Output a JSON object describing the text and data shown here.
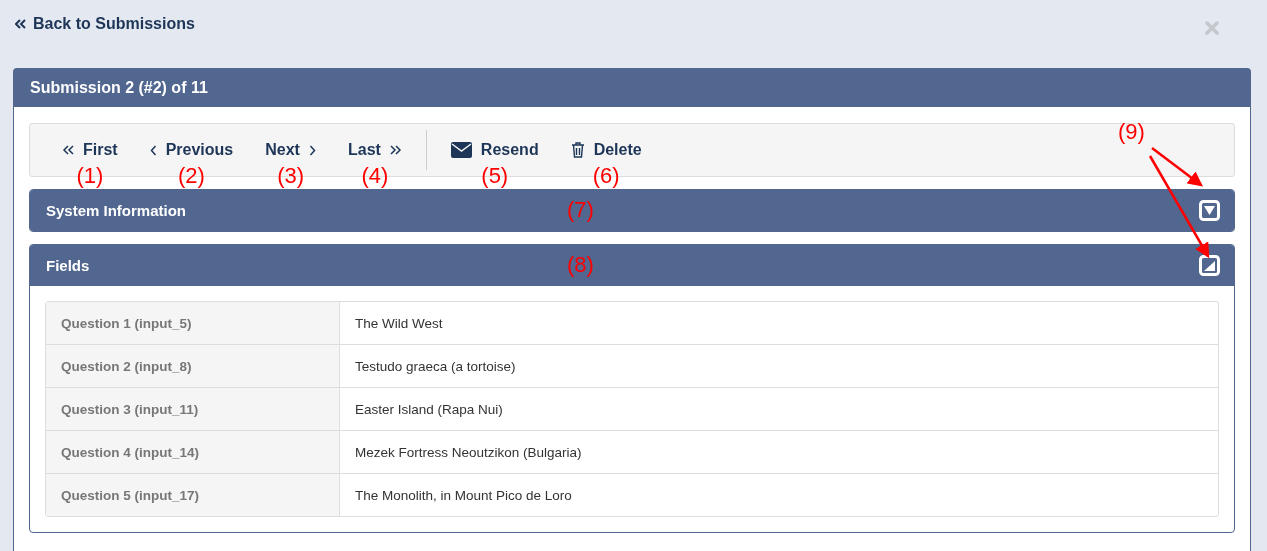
{
  "back_link": {
    "label": "Back to Submissions"
  },
  "panel": {
    "title": "Submission 2 (#2) of 11"
  },
  "toolbar": [
    {
      "kind": "first",
      "label": "First",
      "callout": "(1)"
    },
    {
      "kind": "previous",
      "label": "Previous",
      "callout": "(2)"
    },
    {
      "kind": "next",
      "label": "Next",
      "callout": "(3)"
    },
    {
      "kind": "last",
      "label": "Last",
      "callout": "(4)"
    },
    {
      "kind": "resend",
      "label": "Resend",
      "callout": "(5)"
    },
    {
      "kind": "delete",
      "label": "Delete",
      "callout": "(6)"
    }
  ],
  "sections": [
    {
      "title": "System Information",
      "callout": "(7)",
      "expanded": false
    },
    {
      "title": "Fields",
      "callout": "(8)",
      "expanded": true,
      "rows": [
        {
          "label": "Question 1 (input_5)",
          "value": "The Wild West"
        },
        {
          "label": "Question 2 (input_8)",
          "value": "Testudo graeca (a tortoise)"
        },
        {
          "label": "Question 3 (input_11)",
          "value": "Easter Island (Rapa Nui)"
        },
        {
          "label": "Question 4 (input_14)",
          "value": "Mezek Fortress Neoutzikon (Bulgaria)"
        },
        {
          "label": "Question 5 (input_17)",
          "value": "The Monolith, in Mount Pico de Loro"
        }
      ]
    }
  ],
  "toggle_callout": "(9)"
}
